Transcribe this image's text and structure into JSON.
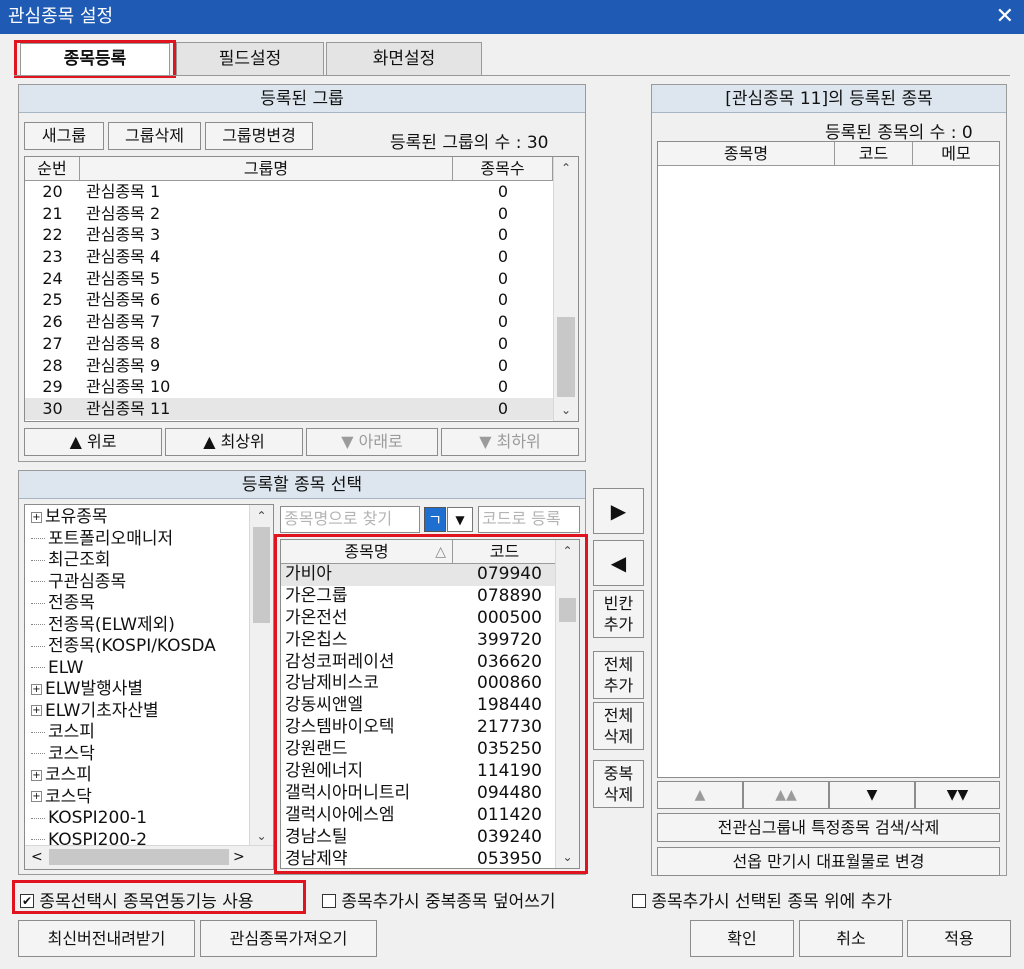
{
  "window": {
    "title": "관심종목 설정",
    "close": "✕"
  },
  "tabs": [
    "종목등록",
    "필드설정",
    "화면설정"
  ],
  "groups": {
    "header": "등록된 그룹",
    "new": "새그룹",
    "delete": "그룹삭제",
    "rename": "그룹명변경",
    "count_text": "등록된 그룹의 수 : 30",
    "cols": [
      "순번",
      "그룹명",
      "종목수"
    ],
    "rows": [
      [
        "20",
        "관심종목 1",
        "0"
      ],
      [
        "21",
        "관심종목 2",
        "0"
      ],
      [
        "22",
        "관심종목 3",
        "0"
      ],
      [
        "23",
        "관심종목 4",
        "0"
      ],
      [
        "24",
        "관심종목 5",
        "0"
      ],
      [
        "25",
        "관심종목 6",
        "0"
      ],
      [
        "26",
        "관심종목 7",
        "0"
      ],
      [
        "27",
        "관심종목 8",
        "0"
      ],
      [
        "28",
        "관심종목 9",
        "0"
      ],
      [
        "29",
        "관심종목 10",
        "0"
      ],
      [
        "30",
        "관심종목 11",
        "0"
      ]
    ],
    "up": "▲ 위로",
    "top": "▲ 최상위",
    "down": "▼ 아래로",
    "bottom": "▼ 최하위"
  },
  "select": {
    "header": "등록할 종목 선택",
    "tree": [
      [
        "+",
        "보유종목"
      ],
      [
        "-",
        "포트폴리오매니저"
      ],
      [
        "-",
        "최근조회"
      ],
      [
        "-",
        "구관심종목"
      ],
      [
        "-",
        "전종목"
      ],
      [
        "-",
        "전종목(ELW제외)"
      ],
      [
        "-",
        "전종목(KOSPI/KOSDA"
      ],
      [
        "-",
        "ELW"
      ],
      [
        "+",
        "ELW발행사별"
      ],
      [
        "+",
        "ELW기초자산별"
      ],
      [
        "-",
        "코스피"
      ],
      [
        "-",
        "코스닥"
      ],
      [
        "+",
        "코스피"
      ],
      [
        "+",
        "코스닥"
      ],
      [
        "-",
        "KOSPI200-1"
      ],
      [
        "-",
        "KOSPI200-2"
      ]
    ],
    "name_search": "종목명으로 찾기",
    "filter": "ㄱ",
    "code_search": "코드로 등록",
    "cols": [
      "종목명",
      "코드"
    ],
    "sort_icon": "△",
    "rows": [
      [
        "가비아",
        "079940"
      ],
      [
        "가온그룹",
        "078890"
      ],
      [
        "가온전선",
        "000500"
      ],
      [
        "가온칩스",
        "399720"
      ],
      [
        "감성코퍼레이션",
        "036620"
      ],
      [
        "강남제비스코",
        "000860"
      ],
      [
        "강동씨앤엘",
        "198440"
      ],
      [
        "강스템바이오텍",
        "217730"
      ],
      [
        "강원랜드",
        "035250"
      ],
      [
        "강원에너지",
        "114190"
      ],
      [
        "갤럭시아머니트리",
        "094480"
      ],
      [
        "갤럭시아에스엠",
        "011420"
      ],
      [
        "경남스틸",
        "039240"
      ],
      [
        "경남제약",
        "053950"
      ]
    ]
  },
  "mid": {
    "add": "▶",
    "remove": "◀",
    "blank_add": "빈칸\n추가",
    "all_add": "전체\n추가",
    "all_del": "전체\n삭제",
    "dup_del": "중복\n삭제"
  },
  "registered": {
    "header": "[관심종목 11]의 등록된 종목",
    "count_text": "등록된 종목의 수 : 0",
    "cols": [
      "종목명",
      "코드",
      "메모"
    ],
    "nav": [
      "▲",
      "▲▲",
      "▼",
      "▼▼"
    ],
    "search_btn": "전관심그룹내 특정종목 검색/삭제",
    "futures_btn": "선옵 만기시 대표월물로 변경"
  },
  "options": {
    "link": "종목선택시 종목연동기능 사용",
    "link_checked": "✔",
    "overwrite": "종목추가시 중복종목 덮어쓰기",
    "insert_above": "종목추가시 선택된 종목 위에 추가"
  },
  "footer": {
    "download": "최신버전내려받기",
    "import": "관심종목가져오기",
    "ok": "확인",
    "cancel": "취소",
    "apply": "적용"
  }
}
